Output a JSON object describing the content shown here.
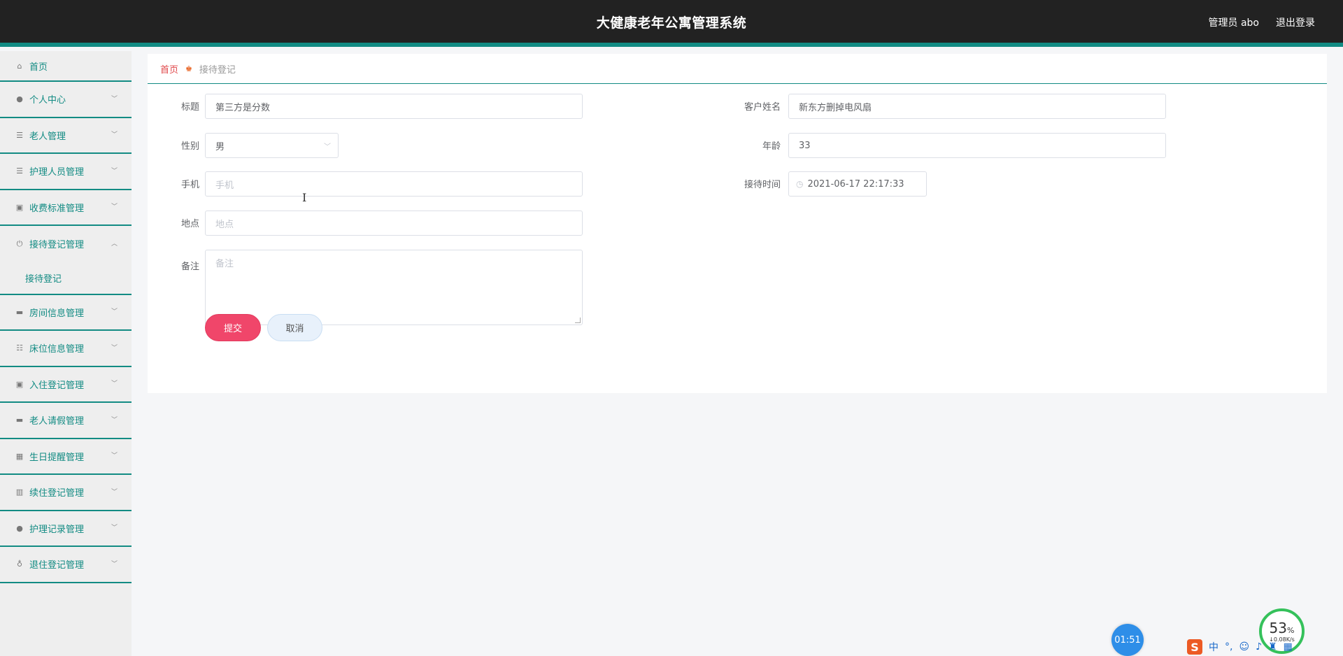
{
  "header": {
    "title": "大健康老年公寓管理系统",
    "user": "管理员 abo",
    "logout": "退出登录"
  },
  "sidebar": {
    "items": [
      {
        "label": "首页",
        "icon": "home-icon"
      },
      {
        "label": "个人中心",
        "icon": "user-icon"
      },
      {
        "label": "老人管理",
        "icon": "list-icon"
      },
      {
        "label": "护理人员管理",
        "icon": "list-icon"
      },
      {
        "label": "收费标准管理",
        "icon": "clipboard-icon"
      },
      {
        "label": "接待登记管理",
        "icon": "power-icon"
      },
      {
        "label": "接待登记",
        "icon": ""
      },
      {
        "label": "房间信息管理",
        "icon": "monitor-icon"
      },
      {
        "label": "床位信息管理",
        "icon": "sliders-icon"
      },
      {
        "label": "入住登记管理",
        "icon": "clipboard-icon"
      },
      {
        "label": "老人请假管理",
        "icon": "drive-icon"
      },
      {
        "label": "生日提醒管理",
        "icon": "grid-icon"
      },
      {
        "label": "续住登记管理",
        "icon": "bar-chart-icon"
      },
      {
        "label": "护理记录管理",
        "icon": "user-icon"
      },
      {
        "label": "退住登记管理",
        "icon": "mic-icon"
      }
    ]
  },
  "breadcrumb": {
    "home": "首页",
    "current": "接待登记"
  },
  "form": {
    "title_label": "标题",
    "title_value": "第三方是分数",
    "customer_label": "客户姓名",
    "customer_value": "新东方删掉电风扇",
    "gender_label": "性别",
    "gender_value": "男",
    "age_label": "年龄",
    "age_value": "33",
    "phone_label": "手机",
    "phone_placeholder": "手机",
    "time_label": "接待时间",
    "time_value": "2021-06-17 22:17:33",
    "place_label": "地点",
    "place_placeholder": "地点",
    "remark_label": "备注",
    "remark_placeholder": "备注",
    "submit": "提交",
    "cancel": "取消"
  },
  "overlay": {
    "timer": "01:51",
    "gauge_percent": "53",
    "gauge_unit": "%",
    "gauge_speed": "↓0.08K/s",
    "tray_ime": "S",
    "tray_lang": "中"
  }
}
